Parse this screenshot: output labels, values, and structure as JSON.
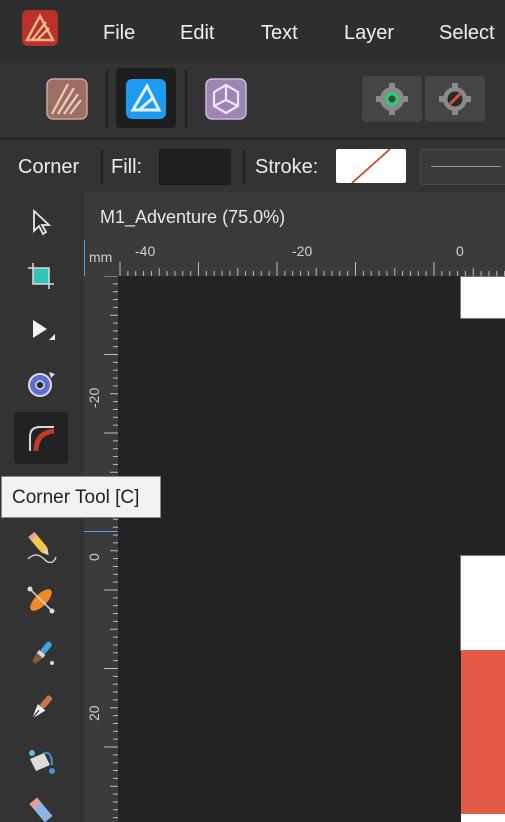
{
  "menu": {
    "items": [
      "File",
      "Edit",
      "Text",
      "Layer",
      "Select"
    ]
  },
  "context_toolbar": {
    "tool_name": "Corner",
    "fill_label": "Fill:",
    "stroke_label": "Stroke:"
  },
  "document": {
    "tab_title": "M1_Adventure (75.0%)",
    "ruler_unit": "mm",
    "h_ruler_labels": [
      "-40",
      "-20",
      "0"
    ],
    "v_ruler_labels": [
      "-20",
      "0",
      "20"
    ]
  },
  "tooltip": {
    "text": "Corner Tool [C]"
  },
  "colors": {
    "accent_blue": "#1e9bf0",
    "brand_red": "#c0392b",
    "artboard_red": "#e35a47"
  }
}
